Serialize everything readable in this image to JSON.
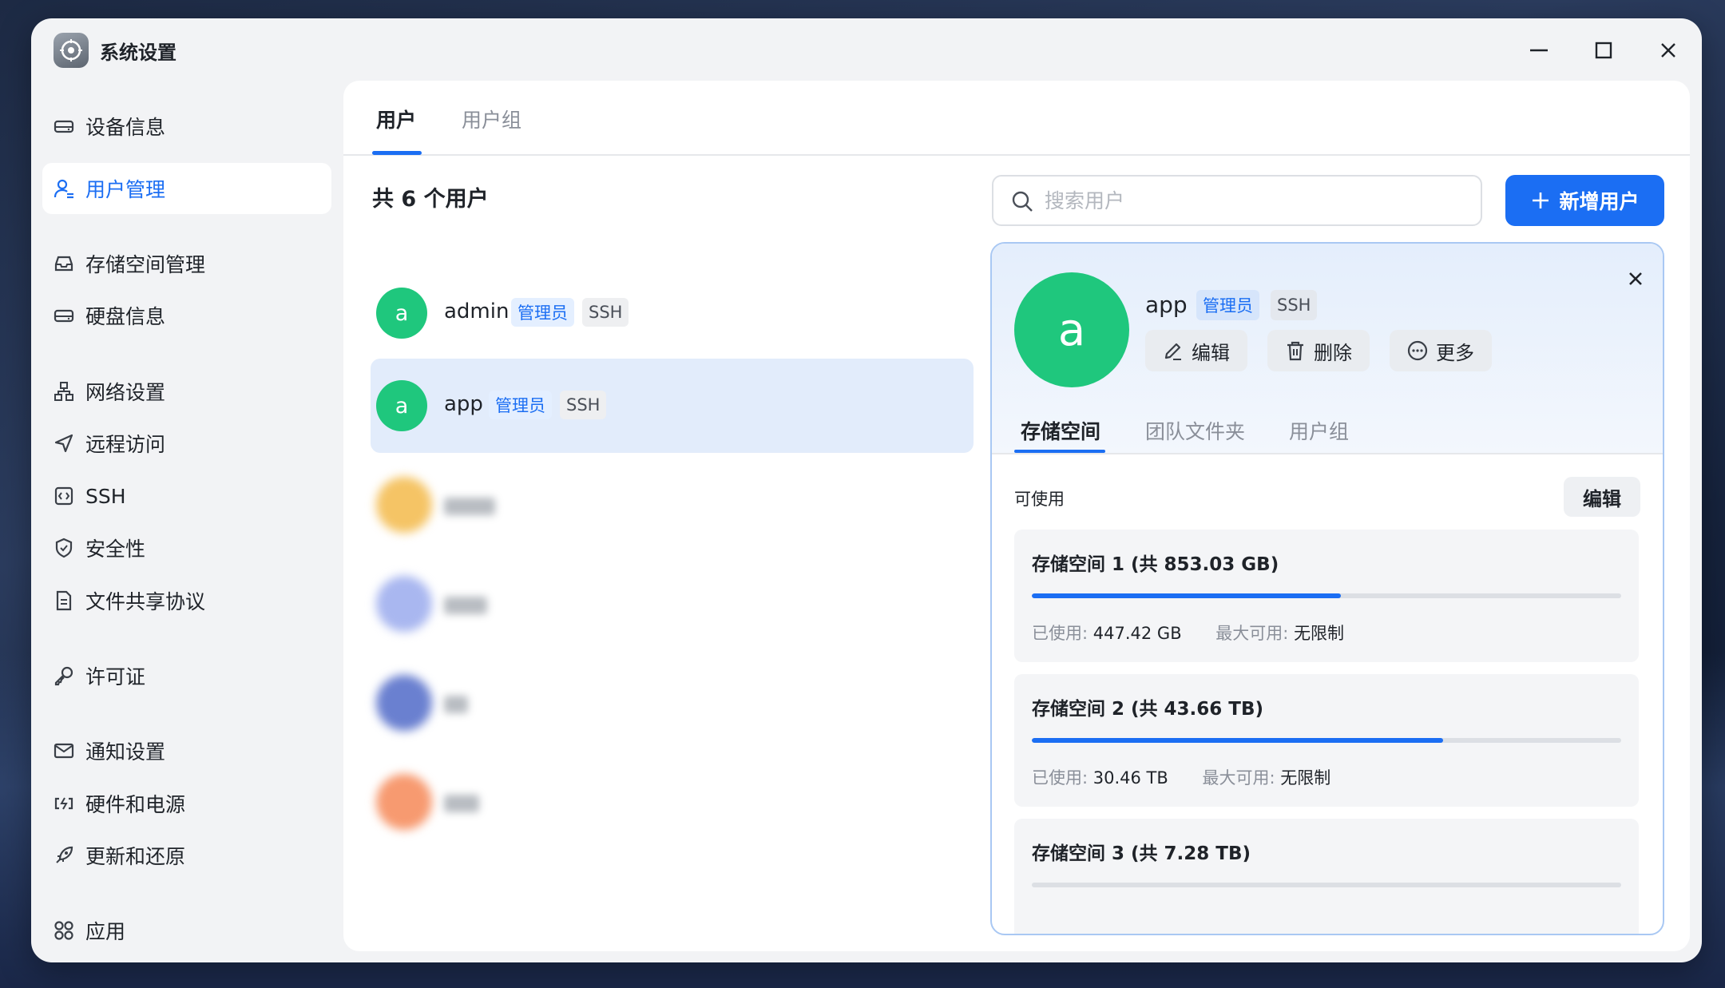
{
  "window": {
    "title": "系统设置"
  },
  "sidebar": {
    "items": [
      {
        "label": "设备信息",
        "icon": "drive-icon",
        "active": false
      },
      {
        "label": "用户管理",
        "icon": "user-manage-icon",
        "active": true
      },
      {
        "label": "存储空间管理",
        "icon": "storage-icon",
        "active": false
      },
      {
        "label": "硬盘信息",
        "icon": "disk-icon",
        "active": false
      },
      {
        "label": "网络设置",
        "icon": "network-icon",
        "active": false
      },
      {
        "label": "远程访问",
        "icon": "send-icon",
        "active": false
      },
      {
        "label": "SSH",
        "icon": "ssh-icon",
        "active": false
      },
      {
        "label": "安全性",
        "icon": "shield-icon",
        "active": false
      },
      {
        "label": "文件共享协议",
        "icon": "document-icon",
        "active": false
      },
      {
        "label": "许可证",
        "icon": "key-icon",
        "active": false
      },
      {
        "label": "通知设置",
        "icon": "mail-icon",
        "active": false
      },
      {
        "label": "硬件和电源",
        "icon": "battery-icon",
        "active": false
      },
      {
        "label": "更新和还原",
        "icon": "rocket-icon",
        "active": false
      },
      {
        "label": "应用",
        "icon": "apps-icon",
        "active": false
      }
    ]
  },
  "main": {
    "tabs": [
      {
        "label": "用户"
      },
      {
        "label": "用户组"
      }
    ],
    "user_count": "共 6 个用户",
    "users": [
      {
        "avatar_letter": "a",
        "name": "admin",
        "role": "管理员",
        "ssh": "SSH"
      },
      {
        "avatar_letter": "a",
        "name": "app",
        "role": "管理员",
        "ssh": "SSH"
      }
    ],
    "search": {
      "placeholder": "搜索用户"
    },
    "add_button": "新增用户"
  },
  "detail": {
    "avatar_letter": "a",
    "name": "app",
    "role": "管理员",
    "ssh": "SSH",
    "actions": {
      "edit": "编辑",
      "delete": "删除",
      "more": "更多"
    },
    "tabs": [
      {
        "label": "存储空间"
      },
      {
        "label": "团队文件夹"
      },
      {
        "label": "用户组"
      }
    ],
    "available_label": "可使用",
    "edit_button": "编辑",
    "storages": [
      {
        "title": "存储空间 1 (共 853.03 GB)",
        "used_label": "已使用:",
        "used": "447.42 GB",
        "max_label": "最大可用:",
        "max": "无限制",
        "fill": 0.524
      },
      {
        "title": "存储空间 2 (共 43.66 TB)",
        "used_label": "已使用:",
        "used": "30.46 TB",
        "max_label": "最大可用:",
        "max": "无限制",
        "fill": 0.698
      },
      {
        "title": "存储空间 3 (共 7.28 TB)",
        "fill": 0.0
      }
    ]
  },
  "colors": {
    "accent": "#1b6ef3",
    "avatar": "#1fc77d"
  }
}
